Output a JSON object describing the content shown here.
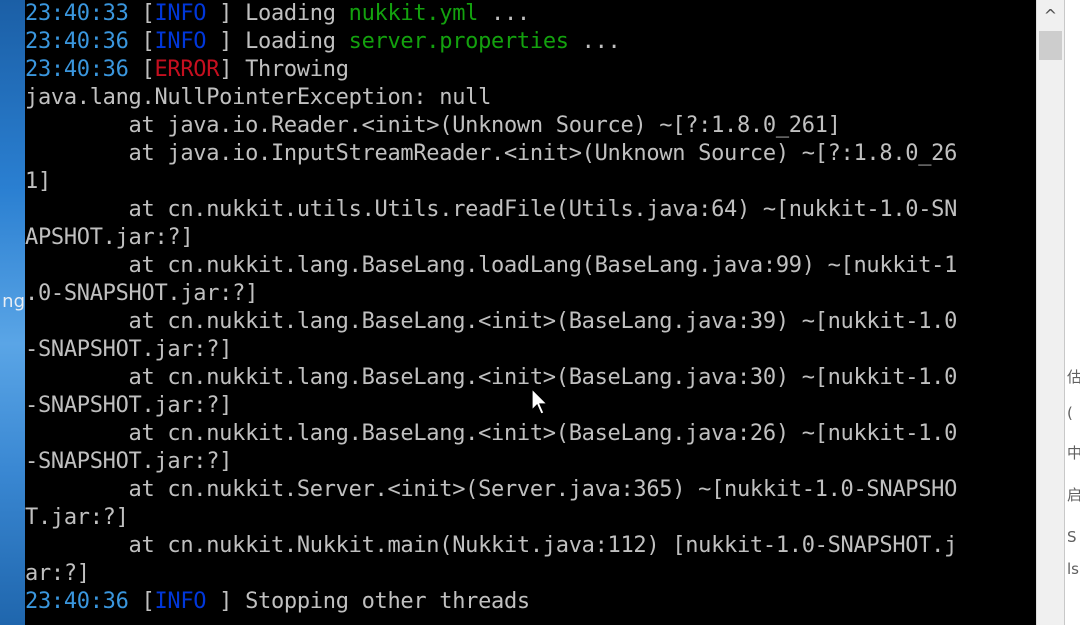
{
  "desktop": {
    "left_label": "ng"
  },
  "console": {
    "lines": [
      {
        "ts": "23:40:33",
        "open": " [",
        "level": "INFO",
        "level_type": "info",
        "close": " ] ",
        "msg": "Loading ",
        "file": "nukkit.yml",
        "tail": " ..."
      },
      {
        "ts": "23:40:36",
        "open": " [",
        "level": "INFO",
        "level_type": "info",
        "close": " ] ",
        "msg": "Loading ",
        "file": "server.properties",
        "tail": " ..."
      },
      {
        "ts": "23:40:36",
        "open": " [",
        "level": "ERROR",
        "level_type": "error",
        "close": "] ",
        "msg": "Throwing",
        "file": "",
        "tail": ""
      },
      {
        "text": "java.lang.NullPointerException: null"
      },
      {
        "text": "        at java.io.Reader.<init>(Unknown Source) ~[?:1.8.0_261]"
      },
      {
        "text": "        at java.io.InputStreamReader.<init>(Unknown Source) ~[?:1.8.0_26"
      },
      {
        "text": "1]"
      },
      {
        "text": "        at cn.nukkit.utils.Utils.readFile(Utils.java:64) ~[nukkit-1.0-SN"
      },
      {
        "text": "APSHOT.jar:?]"
      },
      {
        "text": "        at cn.nukkit.lang.BaseLang.loadLang(BaseLang.java:99) ~[nukkit-1"
      },
      {
        "text": ".0-SNAPSHOT.jar:?]"
      },
      {
        "text": "        at cn.nukkit.lang.BaseLang.<init>(BaseLang.java:39) ~[nukkit-1.0"
      },
      {
        "text": "-SNAPSHOT.jar:?]"
      },
      {
        "text": "        at cn.nukkit.lang.BaseLang.<init>(BaseLang.java:30) ~[nukkit-1.0"
      },
      {
        "text": "-SNAPSHOT.jar:?]"
      },
      {
        "text": "        at cn.nukkit.lang.BaseLang.<init>(BaseLang.java:26) ~[nukkit-1.0"
      },
      {
        "text": "-SNAPSHOT.jar:?]"
      },
      {
        "text": "        at cn.nukkit.Server.<init>(Server.java:365) ~[nukkit-1.0-SNAPSHO"
      },
      {
        "text": "T.jar:?]"
      },
      {
        "text": "        at cn.nukkit.Nukkit.main(Nukkit.java:112) [nukkit-1.0-SNAPSHOT.j"
      },
      {
        "text": "ar:?]"
      },
      {
        "ts": "23:40:36",
        "open": " [",
        "level": "INFO",
        "level_type": "info",
        "close": " ] ",
        "msg": "Stopping other threads",
        "file": "",
        "tail": ""
      }
    ]
  },
  "scrollbar": {
    "up_icon": "chevron-up-icon",
    "up_glyph": "^"
  },
  "bg_window": {
    "glyphs": [
      "估",
      "(",
      "中",
      "S",
      "启",
      "ls"
    ]
  },
  "colors": {
    "timestamp": "#3a96dd",
    "info": "#0037da",
    "error": "#c50f1f",
    "filename": "#13a10e",
    "text": "#c0c0c0",
    "console_bg": "#000000"
  }
}
